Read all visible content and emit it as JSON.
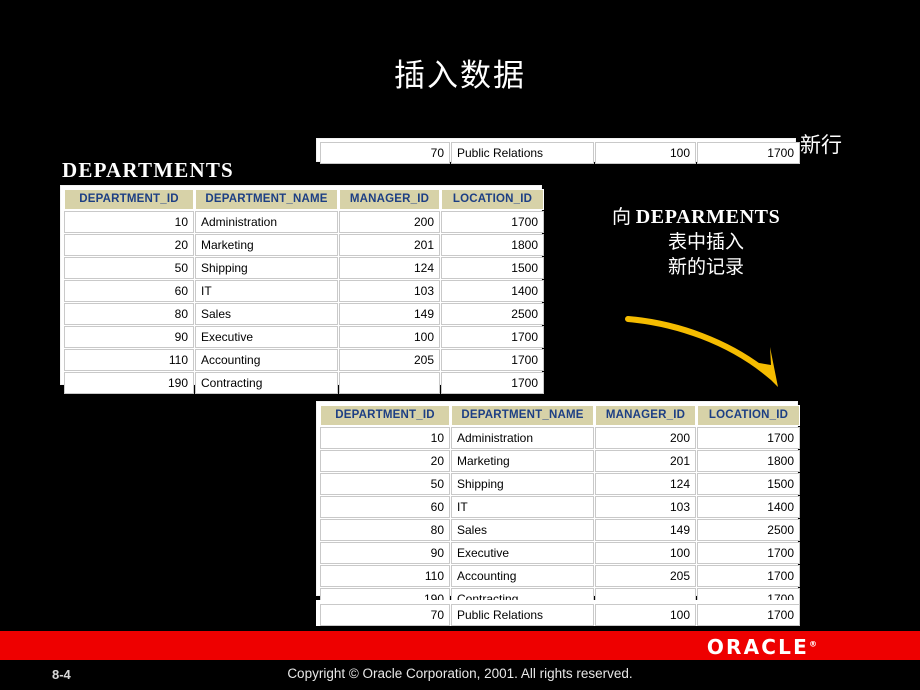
{
  "slide": {
    "title": "插入数据",
    "background_color": "#000000"
  },
  "labels": {
    "departments": "DEPARTMENTS",
    "new_row": "新行",
    "insert_note_line1_cjk": "向",
    "insert_note_line1_roman": "DEPARMENTS",
    "insert_note_line2": "表中插入",
    "insert_note_line3": "新的记录"
  },
  "table": {
    "columns": [
      "DEPARTMENT_ID",
      "DEPARTMENT_NAME",
      "MANAGER_ID",
      "LOCATION_ID"
    ],
    "rows": [
      [
        "10",
        "Administration",
        "200",
        "1700"
      ],
      [
        "20",
        "Marketing",
        "201",
        "1800"
      ],
      [
        "50",
        "Shipping",
        "124",
        "1500"
      ],
      [
        "60",
        "IT",
        "103",
        "1400"
      ],
      [
        "80",
        "Sales",
        "149",
        "2500"
      ],
      [
        "90",
        "Executive",
        "100",
        "1700"
      ],
      [
        "110",
        "Accounting",
        "205",
        "1700"
      ],
      [
        "190",
        "Contracting",
        "",
        "1700"
      ]
    ],
    "new_row": [
      "70",
      "Public Relations",
      "100",
      "1700"
    ]
  },
  "arrow": {
    "color": "#f5bc00"
  },
  "footer": {
    "bar_color": "#ee0000",
    "logo": "ORACLE",
    "logo_mark": "®",
    "page_number": "8-4",
    "copyright": "Copyright © Oracle Corporation, 2001. All rights reserved."
  }
}
